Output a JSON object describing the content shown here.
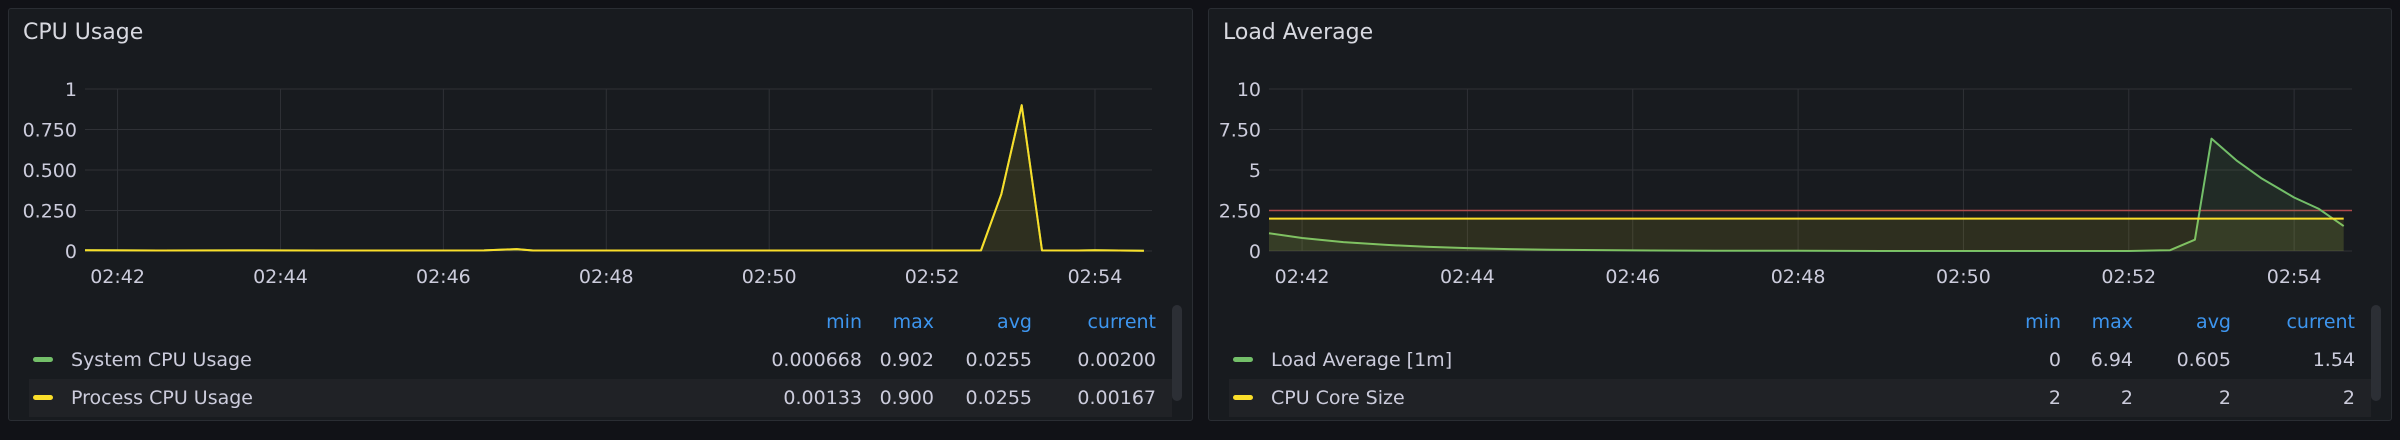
{
  "colors": {
    "green": "#73bf69",
    "yellow": "#fade2a",
    "threshold": "#b04a4a",
    "grid": "#2f3136",
    "header": "#3d95ee"
  },
  "legend_headers": {
    "min": "min",
    "max": "max",
    "avg": "avg",
    "current": "current"
  },
  "panels": {
    "cpu": {
      "title": "CPU Usage",
      "legend": [
        {
          "name": "System CPU Usage",
          "color": "green",
          "min": "0.000668",
          "max": "0.902",
          "avg": "0.0255",
          "current": "0.00200"
        },
        {
          "name": "Process CPU Usage",
          "color": "yellow",
          "min": "0.00133",
          "max": "0.900",
          "avg": "0.0255",
          "current": "0.00167"
        }
      ]
    },
    "load": {
      "title": "Load Average",
      "legend": [
        {
          "name": "Load Average [1m]",
          "color": "green",
          "min": "0",
          "max": "6.94",
          "avg": "0.605",
          "current": "1.54"
        },
        {
          "name": "CPU Core Size",
          "color": "yellow",
          "min": "2",
          "max": "2",
          "avg": "2",
          "current": "2"
        }
      ]
    }
  },
  "chart_data": [
    {
      "type": "line",
      "title": "CPU Usage",
      "x_ticks": [
        "02:42",
        "02:44",
        "02:46",
        "02:48",
        "02:50",
        "02:52",
        "02:54"
      ],
      "y_ticks": [
        "0",
        "0.250",
        "0.500",
        "0.750",
        "1"
      ],
      "ylim": [
        0,
        1
      ],
      "xlim_minutes": [
        41.6,
        54.7
      ],
      "grid": true,
      "legend_position": "bottom",
      "series": [
        {
          "name": "System CPU Usage",
          "color": "green",
          "fill": false,
          "points": [
            [
              41.6,
              0.005
            ],
            [
              42.5,
              0.003
            ],
            [
              43.5,
              0.004
            ],
            [
              44.5,
              0.003
            ],
            [
              45.5,
              0.003
            ],
            [
              46.5,
              0.004
            ],
            [
              46.9,
              0.012
            ],
            [
              47.1,
              0.003
            ],
            [
              48,
              0.003
            ],
            [
              49,
              0.003
            ],
            [
              50,
              0.003
            ],
            [
              51,
              0.003
            ],
            [
              52,
              0.003
            ],
            [
              52.6,
              0.004
            ],
            [
              52.85,
              0.35
            ],
            [
              53.1,
              0.9
            ],
            [
              53.35,
              0.004
            ],
            [
              53.8,
              0.003
            ],
            [
              54,
              0.005
            ],
            [
              54.6,
              0.002
            ]
          ]
        },
        {
          "name": "Process CPU Usage",
          "color": "yellow",
          "fill": true,
          "points": [
            [
              41.6,
              0.005
            ],
            [
              42.5,
              0.003
            ],
            [
              43.5,
              0.004
            ],
            [
              44.5,
              0.003
            ],
            [
              45.5,
              0.003
            ],
            [
              46.5,
              0.004
            ],
            [
              46.9,
              0.012
            ],
            [
              47.1,
              0.003
            ],
            [
              48,
              0.003
            ],
            [
              49,
              0.003
            ],
            [
              50,
              0.003
            ],
            [
              51,
              0.003
            ],
            [
              52,
              0.003
            ],
            [
              52.6,
              0.004
            ],
            [
              52.85,
              0.35
            ],
            [
              53.1,
              0.9
            ],
            [
              53.35,
              0.004
            ],
            [
              53.8,
              0.003
            ],
            [
              54,
              0.005
            ],
            [
              54.6,
              0.002
            ]
          ]
        }
      ]
    },
    {
      "type": "line",
      "title": "Load Average",
      "x_ticks": [
        "02:42",
        "02:44",
        "02:46",
        "02:48",
        "02:50",
        "02:52",
        "02:54"
      ],
      "y_ticks": [
        "0",
        "2.50",
        "5",
        "7.50",
        "10"
      ],
      "ylim": [
        0,
        10
      ],
      "xlim_minutes": [
        41.6,
        54.7
      ],
      "grid": true,
      "legend_position": "bottom",
      "threshold": 2.5,
      "series": [
        {
          "name": "Load Average [1m]",
          "color": "green",
          "fill": true,
          "points": [
            [
              41.6,
              1.1
            ],
            [
              42,
              0.8
            ],
            [
              42.5,
              0.55
            ],
            [
              43,
              0.38
            ],
            [
              43.5,
              0.26
            ],
            [
              44,
              0.18
            ],
            [
              44.5,
              0.12
            ],
            [
              45,
              0.08
            ],
            [
              46,
              0.04
            ],
            [
              47,
              0.02
            ],
            [
              48,
              0.01
            ],
            [
              49,
              0
            ],
            [
              50,
              0
            ],
            [
              51,
              0
            ],
            [
              52,
              0
            ],
            [
              52.5,
              0.05
            ],
            [
              52.8,
              0.7
            ],
            [
              53.0,
              6.94
            ],
            [
              53.3,
              5.6
            ],
            [
              53.6,
              4.5
            ],
            [
              54.0,
              3.3
            ],
            [
              54.3,
              2.6
            ],
            [
              54.6,
              1.54
            ]
          ]
        },
        {
          "name": "CPU Core Size",
          "color": "yellow",
          "fill": true,
          "points": [
            [
              41.6,
              2
            ],
            [
              54.6,
              2
            ]
          ]
        }
      ]
    }
  ]
}
